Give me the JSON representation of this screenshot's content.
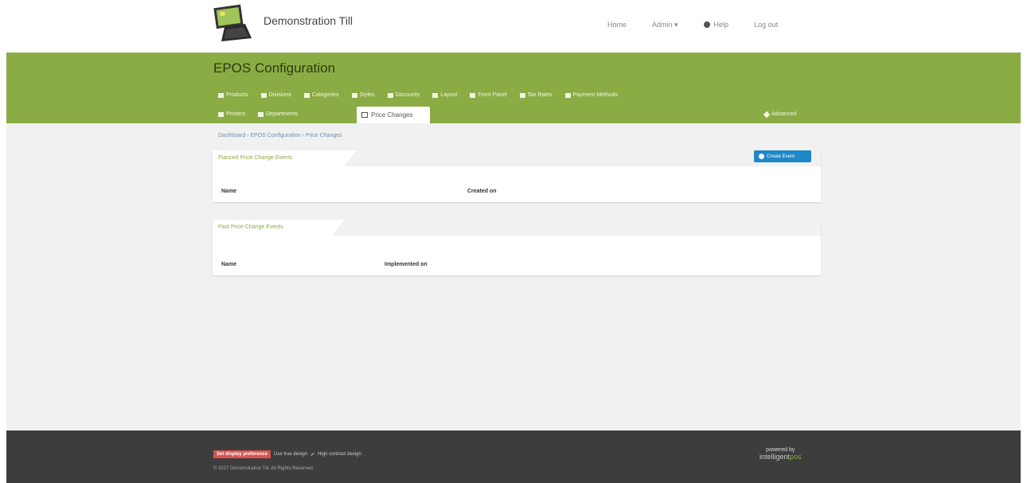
{
  "header": {
    "brand": "Demonstration Till",
    "nav": {
      "home": "Home",
      "admin": "Admin ▾",
      "help": "Help",
      "logout": "Log out"
    }
  },
  "page": {
    "title": "EPOS Configuration",
    "tabs_row1": [
      "Products",
      "Divisions",
      "Categories",
      "Styles",
      "Discounts",
      "Layout",
      "Front Panel",
      "Tax Rates",
      "Payment Methods"
    ],
    "tabs_row2": [
      "Printers",
      "Departments"
    ],
    "active_tab": "Price Changes",
    "advanced_tab": "Advanced"
  },
  "breadcrumb": "Dashboard › EPOS Configuration › Price Changes",
  "planned": {
    "title": "Planned Price Change Events",
    "create_button": "Create Event",
    "columns": [
      "Name",
      "Created on"
    ]
  },
  "past": {
    "title": "Past Price Change Events",
    "columns": [
      "Name",
      "Implemented on"
    ]
  },
  "footer": {
    "badge": "Set display preference",
    "option1": "Use true design",
    "option2": "High contrast design",
    "copyright": "© 2017 Demonstration Till. All Rights Reserved.",
    "powered_by": "powered by",
    "powered_brand_a": "intelligent",
    "powered_brand_b": "pos"
  }
}
